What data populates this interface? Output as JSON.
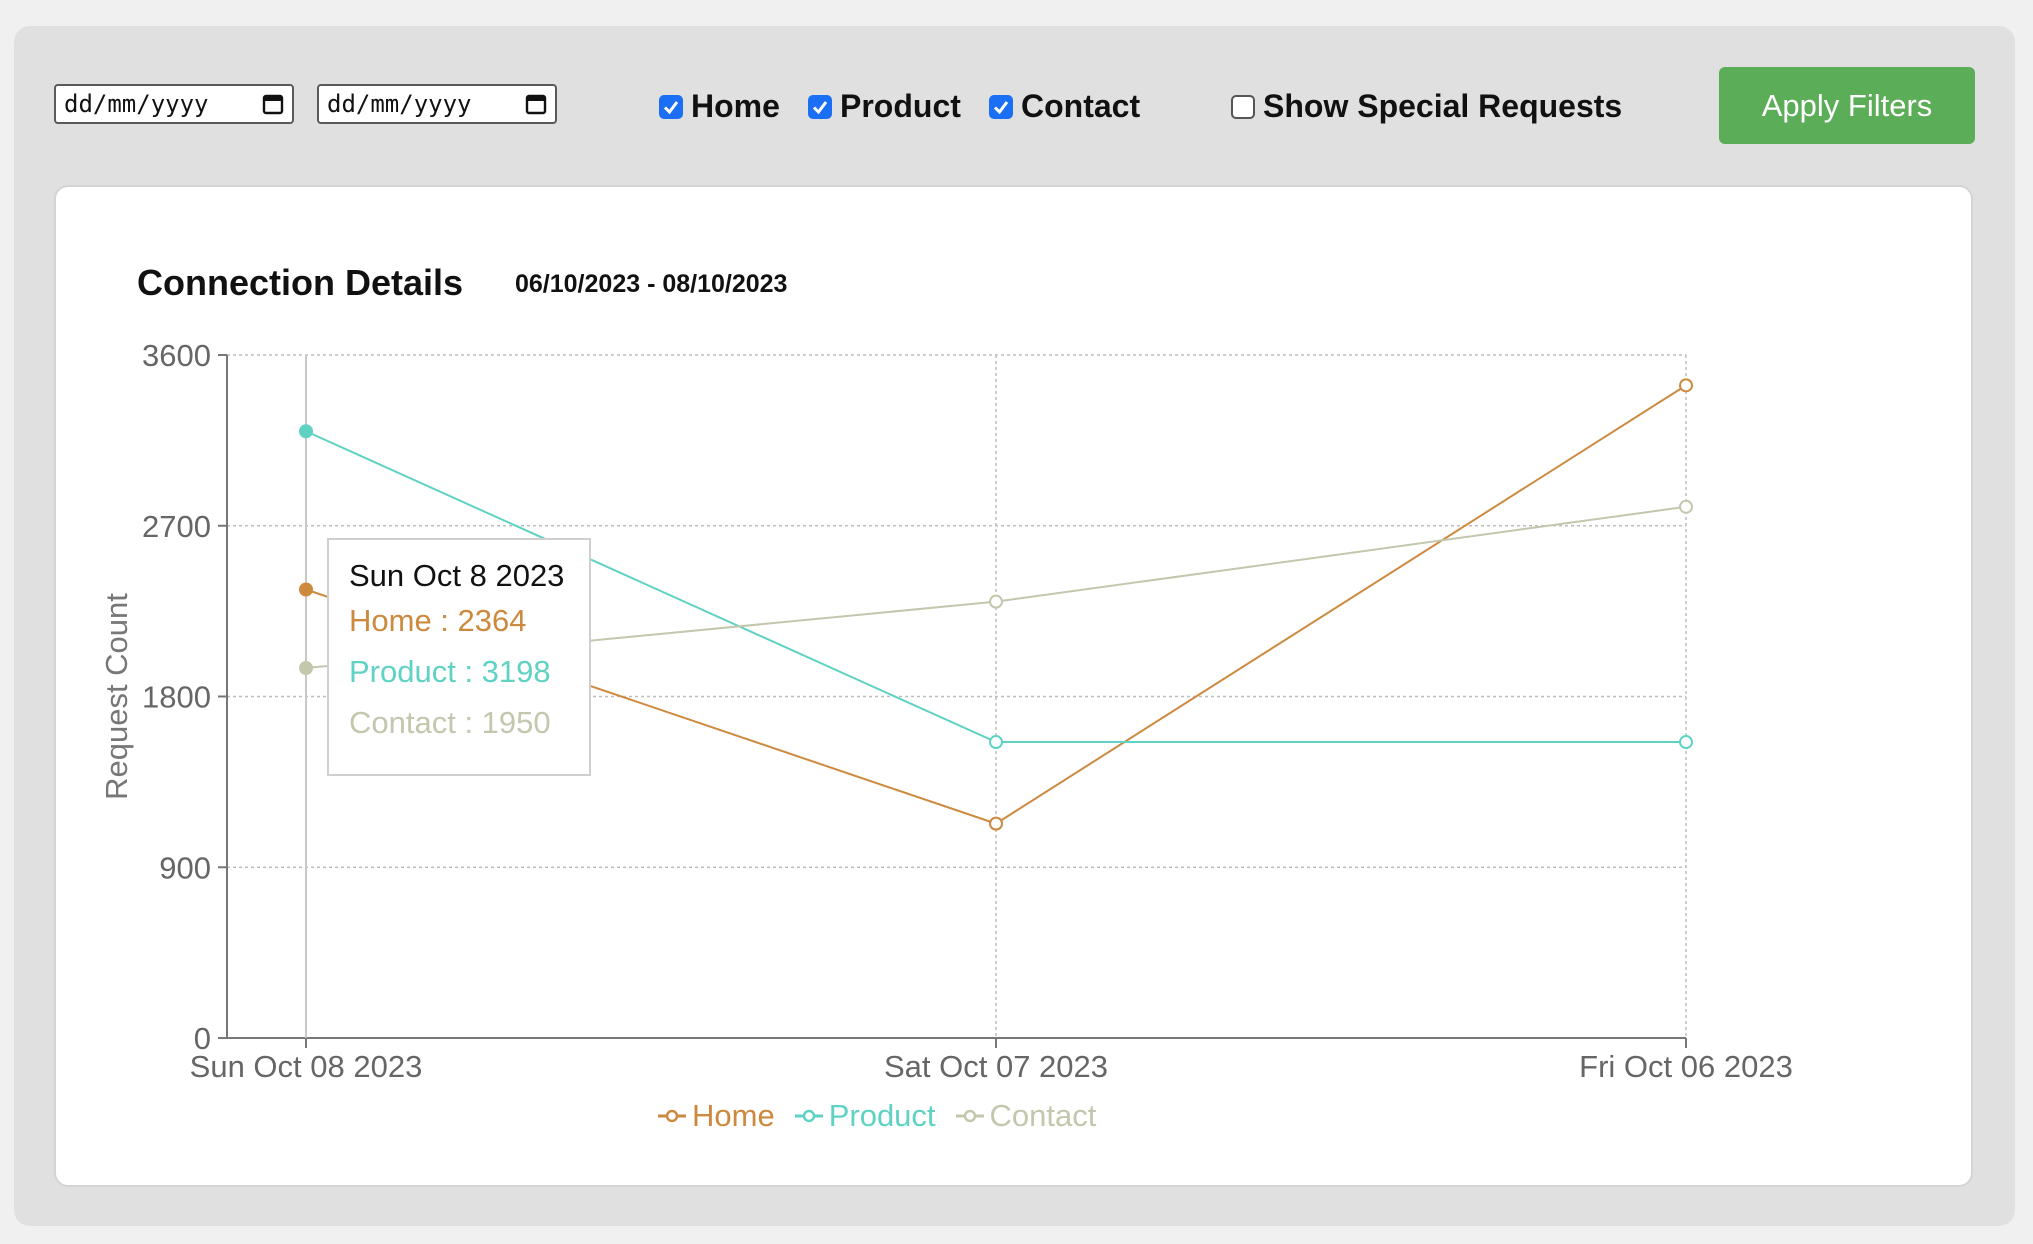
{
  "filters": {
    "start_date_placeholder": "dd/mm/yyyy",
    "end_date_placeholder": "dd/mm/yyyy",
    "checkboxes": [
      {
        "label": "Home",
        "checked": true
      },
      {
        "label": "Product",
        "checked": true
      },
      {
        "label": "Contact",
        "checked": true
      },
      {
        "label": "Show Special Requests",
        "checked": false
      }
    ],
    "apply_label": "Apply Filters"
  },
  "chart_header": {
    "title": "Connection Details",
    "range": "06/10/2023 - 08/10/2023"
  },
  "tooltip": {
    "date": "Sun Oct 8 2023",
    "home": "Home : 2364",
    "product": "Product : 3198",
    "contact": "Contact : 1950"
  },
  "colors": {
    "home": "#cd8a3f",
    "product": "#5fd2c4",
    "contact": "#c3c7ad",
    "accent": "#5cad57",
    "checkbox": "#1a6ff5"
  },
  "chart_data": {
    "type": "line",
    "categories": [
      "Sun Oct 08 2023",
      "Sat Oct 07 2023",
      "Fri Oct 06 2023"
    ],
    "series": [
      {
        "name": "Home",
        "values": [
          2364,
          1130,
          3440
        ]
      },
      {
        "name": "Product",
        "values": [
          3198,
          1560,
          1560
        ]
      },
      {
        "name": "Contact",
        "values": [
          1950,
          2300,
          2800
        ]
      }
    ],
    "ylabel": "Request Count",
    "yticks": [
      0,
      900,
      1800,
      2700,
      3600
    ],
    "ylim": [
      0,
      3600
    ],
    "grid": true,
    "legend": "bottom"
  }
}
